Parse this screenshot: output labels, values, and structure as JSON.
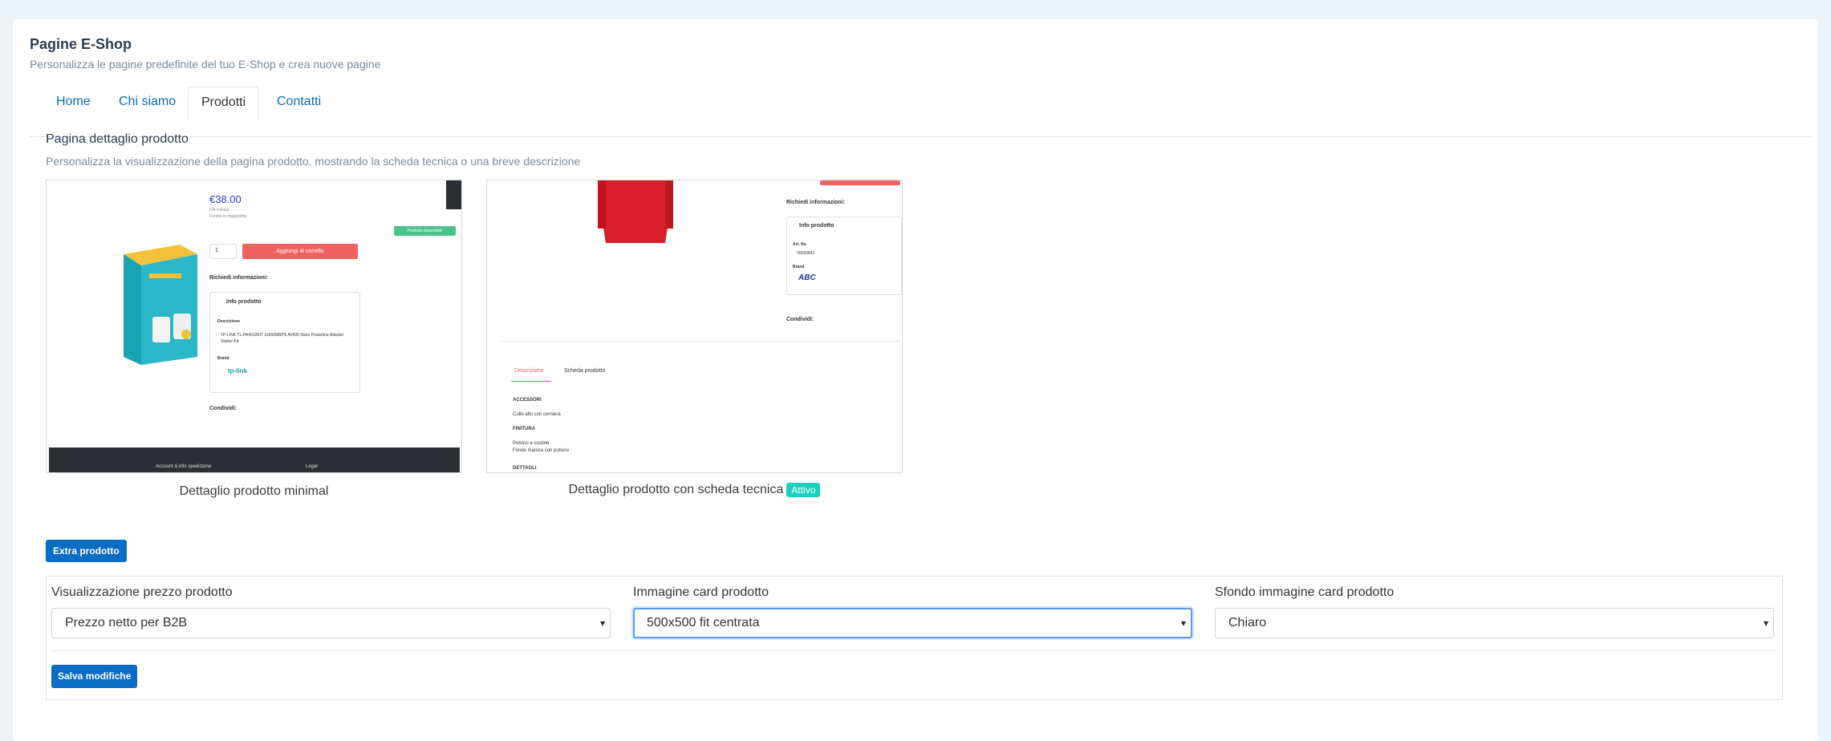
{
  "header": {
    "title": "Pagine E-Shop",
    "subtitle": "Personalizza le pagine predefinite del tuo E-Shop e crea nuove pagine"
  },
  "tabs": [
    {
      "label": "Home",
      "active": false
    },
    {
      "label": "Chi siamo",
      "active": false
    },
    {
      "label": "Prodotti",
      "active": true
    },
    {
      "label": "Contatti",
      "active": false
    }
  ],
  "section": {
    "title": "Pagina dettaglio prodotto",
    "subtitle": "Personalizza la visualizzazione della pagina prodotto, mostrando la scheda tecnica o una breve descrizione"
  },
  "previews": [
    {
      "caption": "Dettaglio prodotto minimal",
      "active": false,
      "mini": {
        "price": "€38.00",
        "vat": "IVA inclusa",
        "stock": "Fornito in magazzino",
        "available": "Prodotto disponibile",
        "qty": "1",
        "add_to_cart": "Aggiungi al carrello",
        "request_info": "Richiedi informazioni:",
        "info_title": "Info prodotto",
        "desc_label": "Descrizione",
        "desc_text": "TP-LINK TL-PA4010KIT 2x500MBPS AV600 Nano Powerline Adapter Starter Kit",
        "brand_label": "Brand",
        "brand": "tp-link",
        "share": "Condividi:",
        "footer_left": "Account & info spedizione",
        "footer_right": "Legal"
      }
    },
    {
      "caption": "Dettaglio prodotto con scheda tecnica",
      "active": true,
      "badge": "Attivo",
      "mini": {
        "request_info": "Richiedi informazioni:",
        "info_title": "Info prodotto",
        "art_label": "Art. No.",
        "art_value": "00093841",
        "brand_label": "Brand",
        "brand": "ABC",
        "share": "Condividi:",
        "tab_desc": "Descrizione",
        "tab_sheet": "Scheda prodotto",
        "h1": "ACCESSORI",
        "t1": "Collo alto con cerniera",
        "h2": "FINITURA",
        "t2a": "Polsino a costine",
        "t2b": "Fondo manica con polsino",
        "h3": "DETTAGLI"
      }
    }
  ],
  "extra_button": "Extra prodotto",
  "form": {
    "price_display": {
      "label": "Visualizzazione prezzo prodotto",
      "value": "Prezzo netto per B2B"
    },
    "card_image": {
      "label": "Immagine card prodotto",
      "value": "500x500 fit centrata"
    },
    "card_bg": {
      "label": "Sfondo immagine card prodotto",
      "value": "Chiaro"
    },
    "save_label": "Salva modifiche"
  },
  "colors": {
    "primary": "#0a6cc3",
    "active_badge": "#17d2c0",
    "accent_red": "#f06262"
  }
}
